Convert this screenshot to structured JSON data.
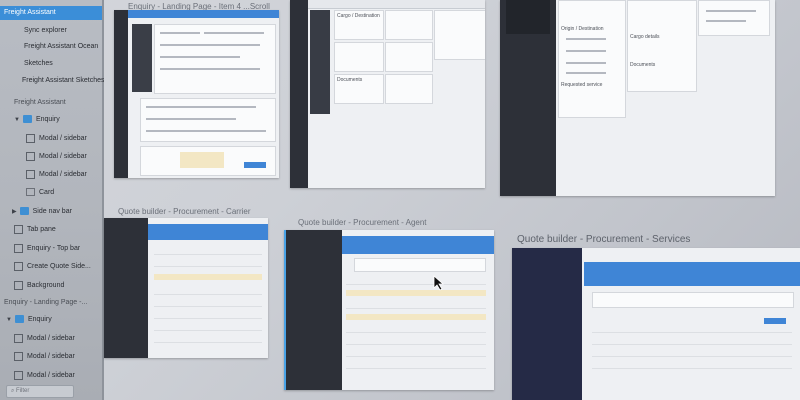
{
  "sidebar": {
    "items": [
      {
        "label": "Freight Assistant",
        "selected": true
      },
      {
        "label": "Sync explorer"
      },
      {
        "label": "Freight Assistant Ocean"
      },
      {
        "label": "Sketches"
      },
      {
        "label": "Freight Assistant Sketches"
      }
    ],
    "section1_title": "Freight Assistant",
    "tree1": [
      {
        "label": "Enquiry"
      },
      {
        "label": "Modal / sidebar"
      },
      {
        "label": "Modal / sidebar"
      },
      {
        "label": "Modal / sidebar"
      },
      {
        "label": "Card"
      },
      {
        "label": "Side nav bar"
      },
      {
        "label": "Tab pane"
      },
      {
        "label": "Enquiry - Top bar"
      },
      {
        "label": "Create Quote Side..."
      },
      {
        "label": "Background"
      }
    ],
    "section2_title": "Enquiry - Landing Page -...",
    "tree2": [
      {
        "label": "Enquiry"
      },
      {
        "label": "Modal / sidebar"
      },
      {
        "label": "Modal / sidebar"
      },
      {
        "label": "Modal / sidebar"
      }
    ],
    "filter_placeholder": "Filter"
  },
  "canvas": {
    "artboards": [
      {
        "title": "Enquiry - Landing Page - Item 4 ...Scroll"
      },
      {
        "title": ""
      },
      {
        "title": ""
      },
      {
        "title": "Quote builder - Procurement - Carrier"
      },
      {
        "title": "Quote builder - Procurement - Agent"
      },
      {
        "title": "Quote builder - Procurement - Services"
      }
    ],
    "labels": {
      "a3_origin": "Origin / Destination",
      "a3_documents": "Documents",
      "a3_cargo": "Cargo details",
      "a3_requested": "Requested service",
      "a2_cargo": "Cargo / Destination",
      "a2_documents": "Documents"
    }
  },
  "colors": {
    "accent": "#3b8ed8",
    "dark_sidebar": "#2d3038",
    "highlight": "#f3e7c4"
  }
}
